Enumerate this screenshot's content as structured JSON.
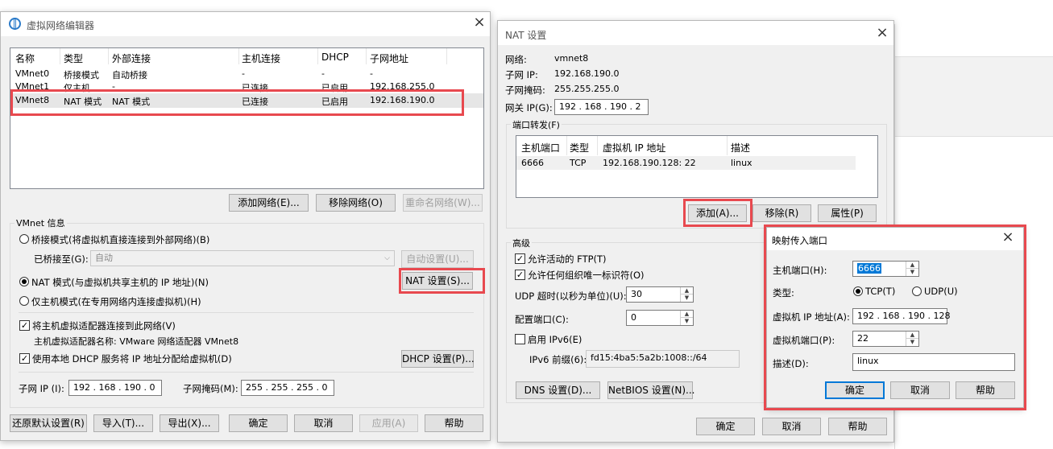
{
  "vne": {
    "title": "虚拟网络编辑器",
    "columns": [
      "名称",
      "类型",
      "外部连接",
      "主机连接",
      "DHCP",
      "子网地址"
    ],
    "rows": [
      [
        "VMnet0",
        "桥接模式",
        "自动桥接",
        "-",
        "-",
        "-"
      ],
      [
        "VMnet1",
        "仅主机...",
        "-",
        "已连接",
        "已启用",
        "192.168.255.0"
      ],
      [
        "VMnet8",
        "NAT 模式",
        "NAT 模式",
        "已连接",
        "已启用",
        "192.168.190.0"
      ]
    ],
    "add_network": "添加网络(E)...",
    "remove_network": "移除网络(O)",
    "rename_network": "重命名网络(W)...",
    "vmnet_info": "VMnet 信息",
    "bridge_mode": "桥接模式(将虚拟机直接连接到外部网络)(B)",
    "bridged_to_label": "已桥接至(G):",
    "bridged_to_value": "自动",
    "auto_settings": "自动设置(U)...",
    "nat_mode": "NAT 模式(与虚拟机共享主机的 IP 地址)(N)",
    "nat_settings": "NAT 设置(S)...",
    "host_only_mode": "仅主机模式(在专用网络内连接虚拟机)(H)",
    "connect_adapter": "将主机虚拟适配器连接到此网络(V)",
    "adapter_name": "主机虚拟适配器名称: VMware 网络适配器 VMnet8",
    "use_dhcp": "使用本地 DHCP 服务将 IP 地址分配给虚拟机(D)",
    "dhcp_settings": "DHCP 设置(P)...",
    "subnet_ip_label": "子网 IP (I):",
    "subnet_ip": "192 . 168 . 190 . 0",
    "subnet_mask_label": "子网掩码(M):",
    "subnet_mask": "255 . 255 . 255 . 0",
    "restore_defaults": "还原默认设置(R)",
    "import": "导入(T)...",
    "export": "导出(X)...",
    "ok": "确定",
    "cancel": "取消",
    "apply": "应用(A)",
    "help": "帮助"
  },
  "nat": {
    "title": "NAT 设置",
    "network_label": "网络:",
    "network": "vmnet8",
    "subnet_ip_label": "子网 IP:",
    "subnet_ip": "192.168.190.0",
    "subnet_mask_label": "子网掩码:",
    "subnet_mask": "255.255.255.0",
    "gateway_label": "网关 IP(G):",
    "gateway": "192 . 168 . 190 . 2",
    "port_forward_label": "端口转发(F)",
    "pf_columns": [
      "主机端口",
      "类型",
      "虚拟机 IP 地址",
      "描述"
    ],
    "pf_rows": [
      [
        "6666",
        "TCP",
        "192.168.190.128: 22",
        "linux"
      ]
    ],
    "add": "添加(A)...",
    "remove": "移除(R)",
    "properties": "属性(P)",
    "advanced_label": "高级",
    "allow_ftp": "允许活动的 FTP(T)",
    "allow_oui": "允许任何组织唯一标识符(O)",
    "udp_timeout_label": "UDP 超时(以秒为单位)(U):",
    "udp_timeout": "30",
    "config_port_label": "配置端口(C):",
    "config_port": "0",
    "enable_ipv6": "启用 IPv6(E)",
    "ipv6_prefix_label": "IPv6 前缀(6):",
    "ipv6_prefix": "fd15:4ba5:5a2b:1008::/64",
    "dns_settings": "DNS 设置(D)...",
    "netbios_settings": "NetBIOS 设置(N)...",
    "ok": "确定",
    "cancel": "取消",
    "help": "帮助"
  },
  "map": {
    "title": "映射传入端口",
    "host_port_label": "主机端口(H):",
    "host_port": "6666",
    "type_label": "类型:",
    "tcp": "TCP(T)",
    "udp": "UDP(U)",
    "vm_ip_label": "虚拟机 IP 地址(A):",
    "vm_ip": "192 . 168 . 190 . 128",
    "vm_port_label": "虚拟机端口(P):",
    "vm_port": "22",
    "desc_label": "描述(D):",
    "desc": "linux",
    "ok": "确定",
    "cancel": "取消",
    "help": "帮助"
  },
  "colors": {
    "highlight": "#e8494f",
    "selected_row": "#e6e6e6",
    "focus": "#0078d7"
  }
}
